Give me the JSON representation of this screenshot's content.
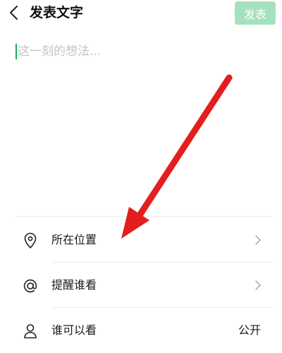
{
  "header": {
    "title": "发表文字",
    "publish_label": "发表",
    "back_icon": "chevron-left-icon",
    "publish_bg_color": "#a4e1bf"
  },
  "compose": {
    "placeholder": "这一刻的想法...",
    "cursor_color": "#1aad5b"
  },
  "options": [
    {
      "icon": "location-pin-icon",
      "label": "所在位置",
      "value": ""
    },
    {
      "icon": "at-sign-icon",
      "label": "提醒谁看",
      "value": ""
    },
    {
      "icon": "person-icon",
      "label": "谁可以看",
      "value": "公开"
    }
  ],
  "annotation": {
    "arrow_color": "#e41e1e"
  }
}
